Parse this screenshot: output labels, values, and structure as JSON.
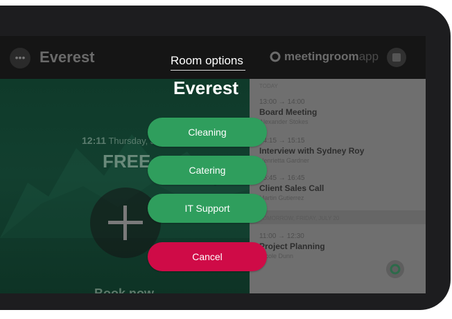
{
  "background": {
    "room_name": "Everest",
    "brand": {
      "bold": "meetingroom",
      "light": "app"
    },
    "time": "12:11",
    "date": "Thursday, July 19",
    "status": "FREE",
    "book_label": "Book now",
    "schedule": {
      "today_label": "TODAY",
      "events": [
        {
          "time": "13:00 → 14:00",
          "name": "Board Meeting",
          "person": "Alexander Stokes"
        },
        {
          "time": "14:15 → 15:15",
          "name": "Interview with Sydney Roy",
          "person": "Henrietta Gardner"
        },
        {
          "time": "15:45 → 16:45",
          "name": "Client Sales Call",
          "person": "Martin Gutierrez"
        }
      ],
      "tomorrow_label": "TOMORROW, FRIDAY, JULY 20",
      "tomorrow_events": [
        {
          "time": "11:00 → 12:30",
          "name": "Project Planning",
          "person": "Nicole Dunn"
        }
      ]
    }
  },
  "modal": {
    "title": "Room options",
    "room": "Everest",
    "options": [
      "Cleaning",
      "Catering",
      "IT Support"
    ],
    "cancel_label": "Cancel"
  },
  "colors": {
    "option_green": "#2f9e5d",
    "cancel_red": "#cf0b47"
  },
  "icons": [
    "more-icon",
    "meetingroomapp-logo-icon",
    "calendar-icon",
    "plus-icon",
    "app-logo-icon"
  ]
}
